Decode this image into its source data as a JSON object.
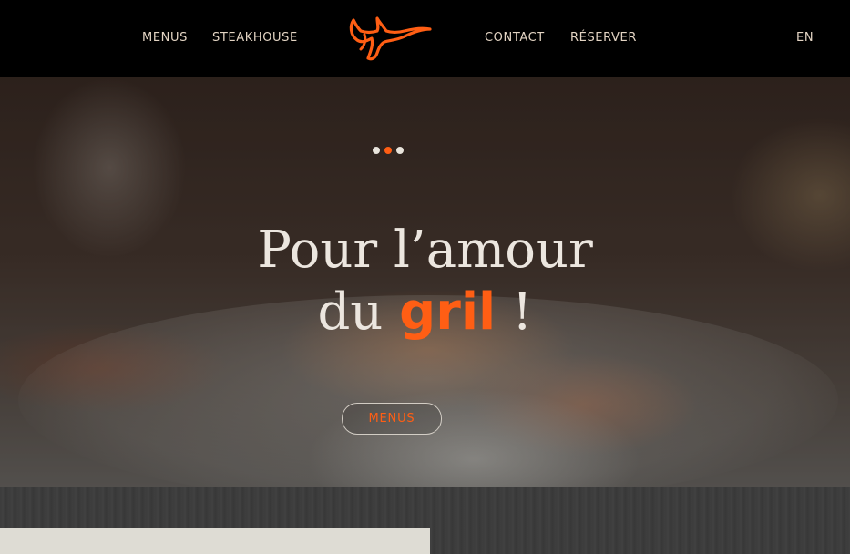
{
  "nav": {
    "left": [
      {
        "label": "MENUS"
      },
      {
        "label": "STEAKHOUSE"
      }
    ],
    "right": [
      {
        "label": "CONTACT"
      },
      {
        "label": "RÉSERVER"
      }
    ],
    "lang": "EN"
  },
  "hero": {
    "slides": {
      "count": 3,
      "active": 2
    },
    "heading_line1": "Pour l’amour",
    "heading_line2_pre": "du ",
    "heading_accent": "gril",
    "heading_line2_post": " !",
    "button_label": "MENUS"
  },
  "colors": {
    "accent": "#ff5e14",
    "nav_text": "#e3d4c3",
    "topbar_bg": "#000000",
    "dot_inactive": "#e8e4dc"
  },
  "icons": {
    "logo": "bull-horns-logo"
  }
}
